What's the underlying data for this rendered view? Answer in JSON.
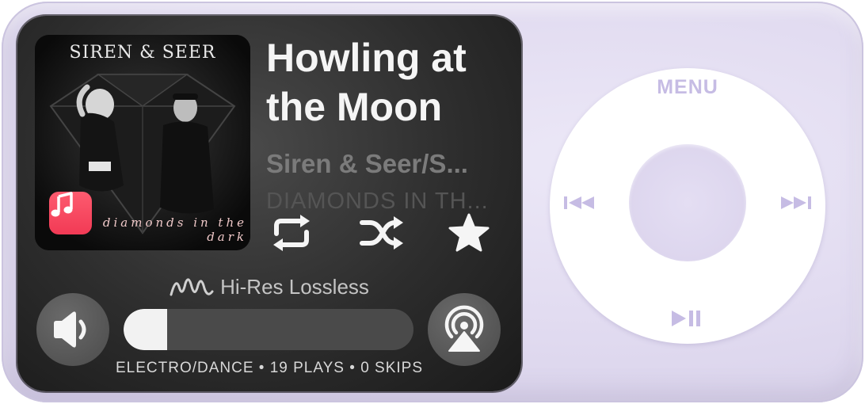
{
  "now_playing": {
    "title": "Howling at the Moon",
    "artist": "Siren & Seer/S...",
    "album": "DIAMONDS IN TH...",
    "artwork": {
      "band_text": "SIREN & SEER",
      "album_text": "diamonds in the dark"
    },
    "source_icon": "apple-music-icon"
  },
  "controls": {
    "repeat_icon": "repeat-icon",
    "shuffle_icon": "shuffle-icon",
    "favorite_icon": "star-icon"
  },
  "audio_quality": {
    "label": "Hi-Res Lossless",
    "icon": "lossless-wave-icon"
  },
  "volume": {
    "level": 0.15,
    "icon": "speaker-icon"
  },
  "airplay": {
    "icon": "airplay-icon"
  },
  "stats": "ELECTRO/DANCE • 19 PLAYS • 0 SKIPS",
  "click_wheel": {
    "menu_label": "MENU",
    "prev_icon": "previous-track-icon",
    "next_icon": "next-track-icon",
    "playpause_icon": "play-pause-icon"
  },
  "colors": {
    "screen_bg": "#2d2d2d",
    "device_body": "#e2dcf1",
    "wheel_glyph": "#c6bce4",
    "music_badge": "#f23a55"
  }
}
